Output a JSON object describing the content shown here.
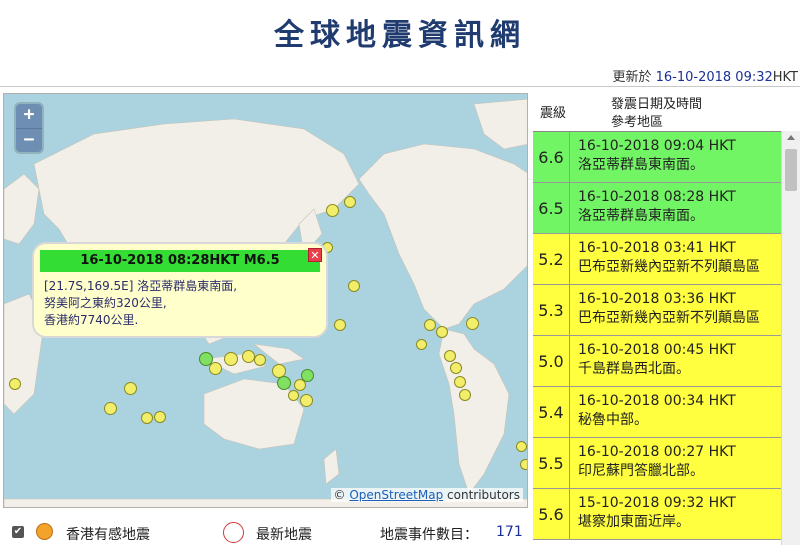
{
  "page": {
    "title": "全球地震資訊網",
    "updated_label": "更新於",
    "updated_time": "16-10-2018 09:32",
    "updated_suffix": "HKT"
  },
  "map": {
    "zoom_in": "+",
    "zoom_out": "−",
    "popup": {
      "title": "16-10-2018 08:28HKT M6.5",
      "close": "✕",
      "line1": "[21.7S,169.5E] 洛亞蒂群島東南面,",
      "line2": "努美阿之東約320公里,",
      "line3": "香港約7740公里."
    },
    "attribution_symbol": "©",
    "attribution_link": "OpenStreetMap",
    "attribution_text": " contributors"
  },
  "legend": {
    "checkbox": "✔",
    "hk_felt": "香港有感地震",
    "latest": "最新地震",
    "count_label": "地震事件數目：",
    "count_value": "171"
  },
  "list": {
    "header_mag": "震級",
    "header_datetime": "發震日期及時間",
    "header_ref": "參考地區",
    "items": [
      {
        "mag": "6.6",
        "datetime": "16-10-2018 09:04 HKT",
        "region": "洛亞蒂群島東南面。",
        "color": "#72f564"
      },
      {
        "mag": "6.5",
        "datetime": "16-10-2018 08:28 HKT",
        "region": "洛亞蒂群島東南面。",
        "color": "#72f564"
      },
      {
        "mag": "5.2",
        "datetime": "16-10-2018 03:41 HKT",
        "region": "巴布亞新幾內亞新不列顛島區",
        "color": "#ffff40"
      },
      {
        "mag": "5.3",
        "datetime": "16-10-2018 03:36 HKT",
        "region": "巴布亞新幾內亞新不列顛島區",
        "color": "#ffff40"
      },
      {
        "mag": "5.0",
        "datetime": "16-10-2018 00:45 HKT",
        "region": "千島群島西北面。",
        "color": "#ffff40"
      },
      {
        "mag": "5.4",
        "datetime": "16-10-2018 00:34 HKT",
        "region": "秘魯中部。",
        "color": "#ffff40"
      },
      {
        "mag": "5.5",
        "datetime": "16-10-2018 00:27 HKT",
        "region": "印尼蘇門答臘北部。",
        "color": "#ffff40"
      },
      {
        "mag": "5.6",
        "datetime": "15-10-2018 09:32 HKT",
        "region": "堪察加東面近岸。",
        "color": "#ffff40"
      }
    ]
  }
}
